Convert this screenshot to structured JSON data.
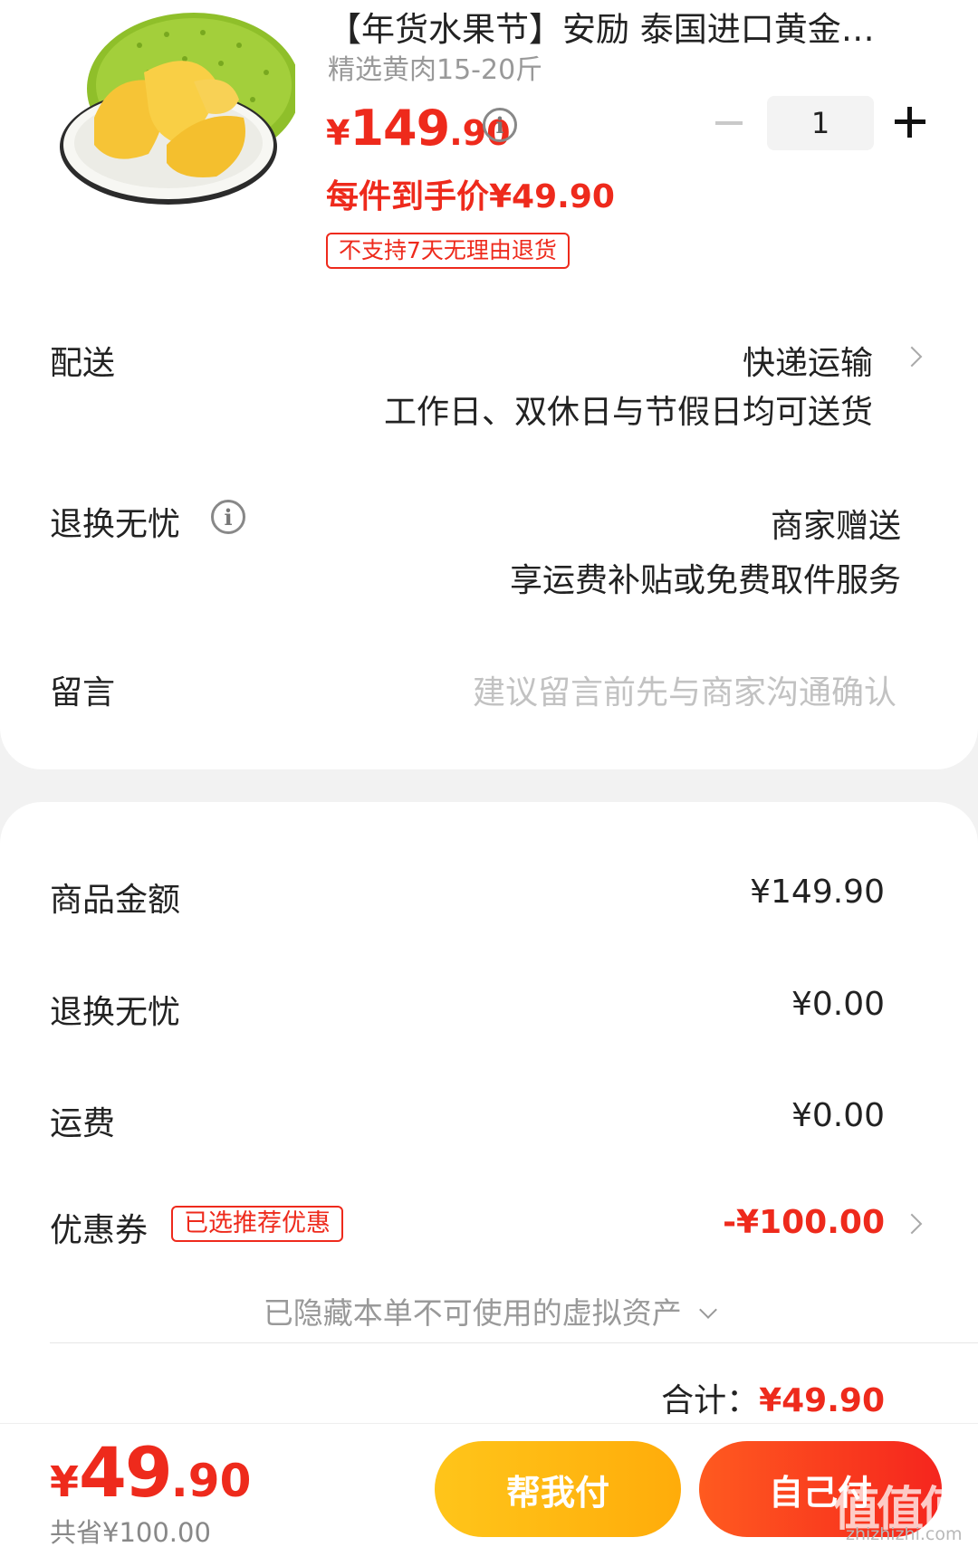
{
  "product": {
    "title": "【年货水果节】安励 泰国进口黄金菠萝蜜…",
    "spec": "精选黄肉15-20斤",
    "price_currency": "¥",
    "price_int": "149",
    "price_dec": ".90",
    "quantity": "1",
    "per_price": "每件到手价¥49.90",
    "return_tag": "不支持7天无理由退货",
    "image_icon": "jackfruit-image"
  },
  "delivery": {
    "label": "配送",
    "method": "快递运输",
    "note": "工作日、双休日与节假日均可送货"
  },
  "return_worry_free": {
    "label": "退换无忧",
    "value": "商家赠送",
    "note": "享运费补贴或免费取件服务"
  },
  "message": {
    "label": "留言",
    "placeholder": "建议留言前先与商家沟通确认"
  },
  "summary": {
    "goods_label": "商品金额",
    "goods_value": "¥149.90",
    "return_label": "退换无忧",
    "return_value": "¥0.00",
    "shipping_label": "运费",
    "shipping_value": "¥0.00",
    "coupon_label": "优惠券",
    "coupon_tag": "已选推荐优惠",
    "coupon_value": "-¥100.00",
    "hidden_assets": "已隐藏本单不可使用的虚拟资产",
    "total_label": "合计：",
    "total_value": "¥49.90"
  },
  "bottom_bar": {
    "price_currency": "¥",
    "price_int": "49",
    "price_dec": ".90",
    "saved": "共省¥100.00",
    "help_pay_label": "帮我付",
    "self_pay_label": "自己付",
    "watermark": "值值值",
    "watermark_url": "zhizhizhi.com"
  },
  "colors": {
    "accent_red": "#ee2a1c",
    "help_button": "#ffb812",
    "self_button": "#f5301e"
  }
}
